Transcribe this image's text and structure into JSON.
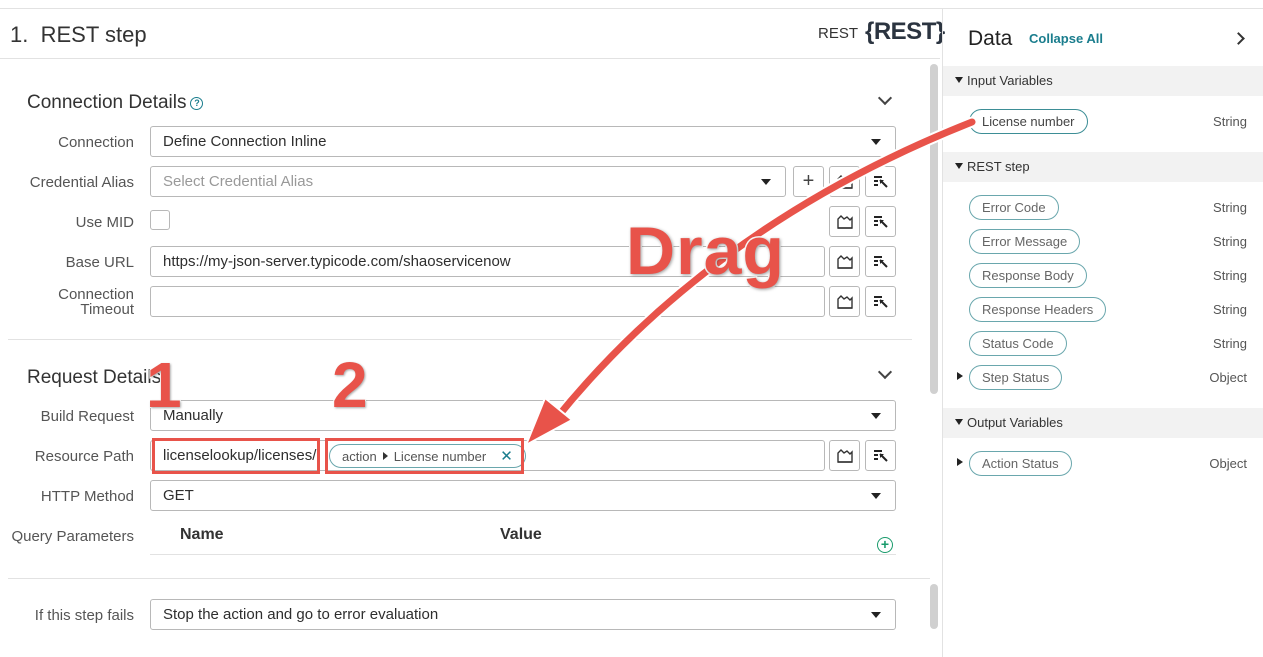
{
  "step": {
    "number": "1.",
    "title": "REST step",
    "type_label": "REST",
    "logo": "{REST}"
  },
  "connection": {
    "title": "Connection Details",
    "fields": {
      "connection_label": "Connection",
      "connection_value": "Define Connection Inline",
      "credential_label": "Credential Alias",
      "credential_placeholder": "Select Credential Alias",
      "use_mid_label": "Use MID",
      "base_url_label": "Base URL",
      "base_url_value": "https://my-json-server.typicode.com/shaoservicenow",
      "timeout_label_1": "Connection",
      "timeout_label_2": "Timeout",
      "timeout_value": ""
    }
  },
  "request": {
    "title": "Request Details",
    "build_request_label": "Build Request",
    "build_request_value": "Manually",
    "resource_path_label": "Resource Path",
    "resource_path_text": "licenselookup/licenses/",
    "pill_prefix": "action",
    "pill_value": "License number",
    "http_method_label": "HTTP Method",
    "http_method_value": "GET",
    "query_params_label": "Query Parameters",
    "col_name": "Name",
    "col_value": "Value"
  },
  "failure": {
    "label": "If this step fails",
    "value": "Stop the action and go to error evaluation"
  },
  "data_panel": {
    "title": "Data",
    "collapse_all": "Collapse All",
    "input_group": "Input Variables",
    "input_vars": [
      {
        "name": "License number",
        "type": "String"
      }
    ],
    "rest_group": "REST step",
    "rest_vars": [
      {
        "name": "Error Code",
        "type": "String"
      },
      {
        "name": "Error Message",
        "type": "String"
      },
      {
        "name": "Response Body",
        "type": "String"
      },
      {
        "name": "Response Headers",
        "type": "String"
      },
      {
        "name": "Status Code",
        "type": "String"
      },
      {
        "name": "Step Status",
        "type": "Object"
      }
    ],
    "output_group": "Output Variables",
    "output_vars": [
      {
        "name": "Action Status",
        "type": "Object"
      }
    ]
  },
  "annotations": {
    "num1": "1",
    "num2": "2",
    "drag": "Drag",
    "color": "#e8534a"
  },
  "icons": {
    "field_icons": [
      "script-icon",
      "data-pill-picker-icon"
    ],
    "add_icon": "plus-icon",
    "query_add": "add-circle-icon"
  }
}
